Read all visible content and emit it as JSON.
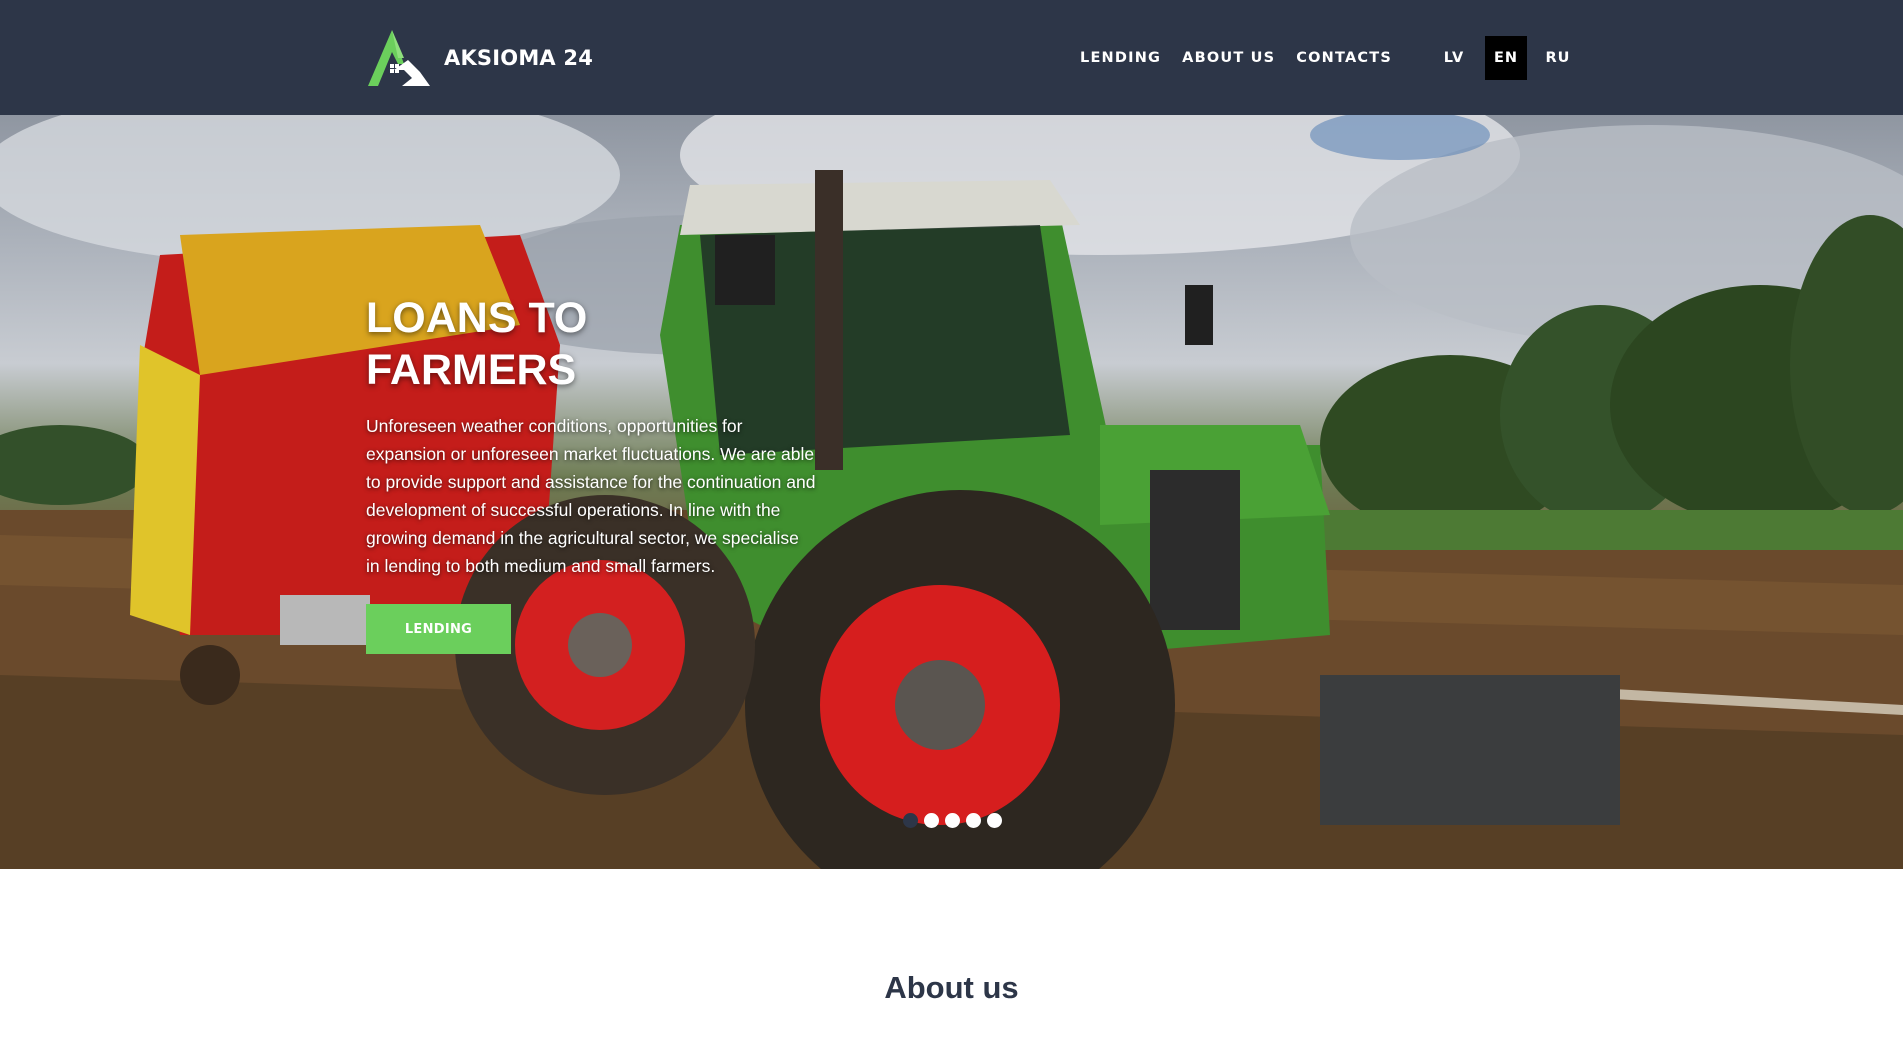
{
  "header": {
    "logo_text": "AKSIOMA 24",
    "nav": [
      "LENDING",
      "ABOUT US",
      "CONTACTS"
    ],
    "languages": [
      "LV",
      "EN",
      "RU"
    ],
    "active_language": "EN"
  },
  "hero": {
    "title_line1": "LOANS TO",
    "title_line2": "FARMERS",
    "text": "Unforeseen weather conditions, opportunities for expansion or unforeseen market fluctuations. We are able to provide support and assistance for the continuation and development of successful operations. In line with the growing demand in the agricultural sector, we specialise in lending to both medium and small farmers.",
    "button_label": "LENDING",
    "slide_count": 5,
    "active_slide": 1,
    "image_subject": "tractor-in-field"
  },
  "about": {
    "title": "About us"
  },
  "colors": {
    "header_bg": "#2d3648",
    "accent_green": "#6bcf5c",
    "active_lang_bg": "#000000"
  }
}
